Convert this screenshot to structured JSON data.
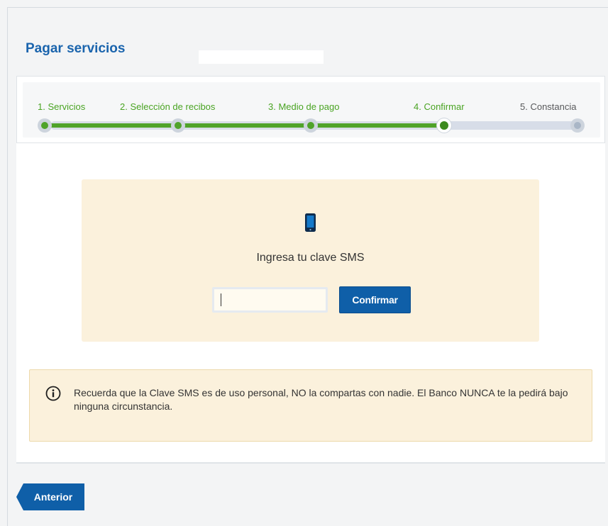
{
  "header": {
    "title": "Pagar servicios"
  },
  "stepper": {
    "steps": [
      {
        "label": "1. Servicios",
        "state": "done"
      },
      {
        "label": "2. Selección de recibos",
        "state": "done"
      },
      {
        "label": "3. Medio de pago",
        "state": "done"
      },
      {
        "label": "4. Confirmar",
        "state": "current"
      },
      {
        "label": "5. Constancia",
        "state": "pending"
      }
    ],
    "progress": 0.75,
    "colors": {
      "done": "#4fa32a",
      "pending": "#a9b6c6"
    }
  },
  "sms": {
    "icon": "mobile-phone-icon",
    "label": "Ingresa tu clave SMS",
    "input_value": "",
    "confirm_label": "Confirmar"
  },
  "notice": {
    "icon": "info-circle-icon",
    "text": "Recuerda que la Clave SMS es de uso personal, NO la compartas con nadie. El Banco NUNCA te la pedirá bajo ninguna circunstancia."
  },
  "footer": {
    "back_label": "Anterior"
  },
  "colors": {
    "primary": "#0f5fa8",
    "title": "#1a64ad",
    "panel": "#fbf1dc"
  }
}
